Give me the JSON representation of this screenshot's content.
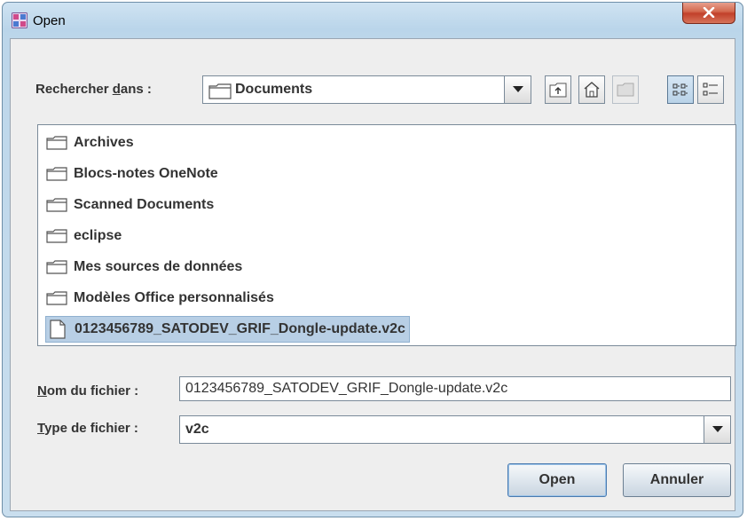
{
  "window": {
    "title": "Open"
  },
  "look_in": {
    "label_prefix": "Rechercher ",
    "label_mnemonic": "d",
    "label_suffix": "ans :",
    "value": "Documents"
  },
  "toolbar": {
    "buttons": [
      {
        "name": "up-one-level-icon"
      },
      {
        "name": "home-icon"
      },
      {
        "name": "new-folder-icon",
        "disabled": true
      },
      {
        "name": "list-view-icon",
        "selected": true
      },
      {
        "name": "details-view-icon"
      }
    ]
  },
  "files": [
    {
      "name": "Archives",
      "type": "folder"
    },
    {
      "name": "Blocs-notes OneNote",
      "type": "folder"
    },
    {
      "name": "Scanned Documents",
      "type": "folder"
    },
    {
      "name": "eclipse",
      "type": "folder"
    },
    {
      "name": "Mes sources de données",
      "type": "folder"
    },
    {
      "name": "Modèles Office personnalisés",
      "type": "folder"
    },
    {
      "name": "0123456789_SATODEV_GRIF_Dongle-update.v2c",
      "type": "file",
      "selected": true
    }
  ],
  "file_name": {
    "label_mnemonic": "N",
    "label_suffix": "om du fichier :",
    "value": "0123456789_SATODEV_GRIF_Dongle-update.v2c"
  },
  "file_type": {
    "label_mnemonic": "T",
    "label_suffix": "ype de fichier :",
    "value": "v2c"
  },
  "buttons": {
    "open": "Open",
    "cancel": "Annuler"
  },
  "colors": {
    "selection": "#b8cfe5",
    "close_button": "#c9462f",
    "dialog_bg": "#eeeeee"
  }
}
